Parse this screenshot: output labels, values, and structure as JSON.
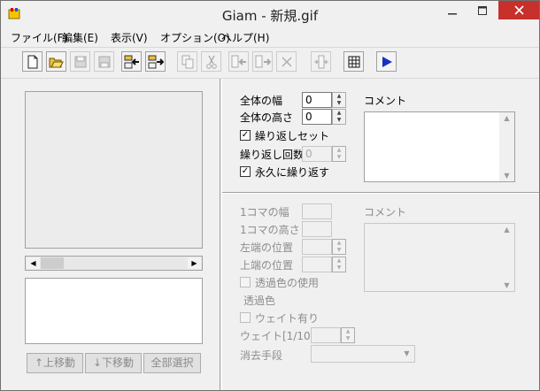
{
  "window": {
    "title": "Giam - 新規.gif"
  },
  "icons": {
    "app": "giam-app-icon",
    "minimize": "minimize-icon",
    "maximize": "maximize-icon",
    "close": "close-icon"
  },
  "menu": [
    "ファイル(F)",
    "編集(E)",
    "表示(V)",
    "オプション(O)",
    "ヘルプ(H)"
  ],
  "toolbar": {
    "buttons": [
      {
        "icon": "new-file-icon",
        "enabled": true
      },
      {
        "icon": "open-folder-icon",
        "enabled": true
      },
      {
        "icon": "save-icon",
        "enabled": false
      },
      {
        "icon": "save-as-icon",
        "enabled": false
      },
      {
        "icon": "import-frames-icon",
        "enabled": true
      },
      {
        "icon": "insert-frames-icon",
        "enabled": true
      },
      {
        "icon": "copy-icon",
        "enabled": false
      },
      {
        "icon": "cut-icon",
        "enabled": false
      },
      {
        "icon": "paste-before-icon",
        "enabled": false
      },
      {
        "icon": "paste-after-icon",
        "enabled": false
      },
      {
        "icon": "delete-icon",
        "enabled": false
      },
      {
        "icon": "merge-frames-icon",
        "enabled": false
      },
      {
        "icon": "grid-icon",
        "enabled": true
      },
      {
        "icon": "play-icon",
        "enabled": true
      }
    ]
  },
  "left": {
    "buttons": {
      "move_up": "↑上移動",
      "move_down": "↓下移動",
      "select_all": "全部選択"
    }
  },
  "global": {
    "width_label": "全体の幅",
    "width_value": "0",
    "height_label": "全体の高さ",
    "height_value": "0",
    "loop_set_label": "繰り返しセット",
    "loop_set_checked": true,
    "loop_count_label": "繰り返し回数",
    "loop_count_value": "0",
    "loop_forever_label": "永久に繰り返す",
    "loop_forever_checked": true,
    "comment_label": "コメント"
  },
  "frame": {
    "width_label": "1コマの幅",
    "height_label": "1コマの高さ",
    "left_label": "左端の位置",
    "top_label": "上端の位置",
    "transparent_use_label": "透過色の使用",
    "transparent_color_label": "透過色",
    "wait_label": "ウェイト有り",
    "wait_unit_label": "ウェイト[1/100s]",
    "dispose_label": "消去手段",
    "comment_label": "コメント"
  }
}
